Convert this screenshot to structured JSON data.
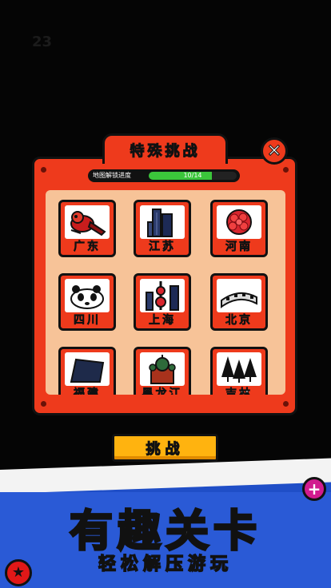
{
  "background": {
    "level_text": "23"
  },
  "modal": {
    "title": "特殊挑战",
    "close_icon": "✕",
    "progress": {
      "label": "地图解锁进度",
      "text": "10/14",
      "fraction": 0.714
    }
  },
  "provinces": [
    {
      "name": "广东",
      "icon": "lion-dance-icon"
    },
    {
      "name": "江苏",
      "icon": "skyscraper-icon"
    },
    {
      "name": "河南",
      "icon": "peony-icon"
    },
    {
      "name": "四川",
      "icon": "panda-icon"
    },
    {
      "name": "上海",
      "icon": "oriental-pearl-tower-icon"
    },
    {
      "name": "北京",
      "icon": "great-wall-icon"
    },
    {
      "name": "福建",
      "icon": "landmark-icon"
    },
    {
      "name": "黑龙江",
      "icon": "cathedral-icon"
    },
    {
      "name": "吉林",
      "icon": "pine-trees-icon"
    }
  ],
  "challenge_button": {
    "label": "挑战"
  },
  "banner": {
    "headline": "有趣关卡",
    "subline": "轻松解压游玩"
  },
  "colors": {
    "primary": "#ee3a1c",
    "accent": "#ffb30f",
    "banner": "#1f4ec7",
    "progress": "#3bc63b"
  }
}
